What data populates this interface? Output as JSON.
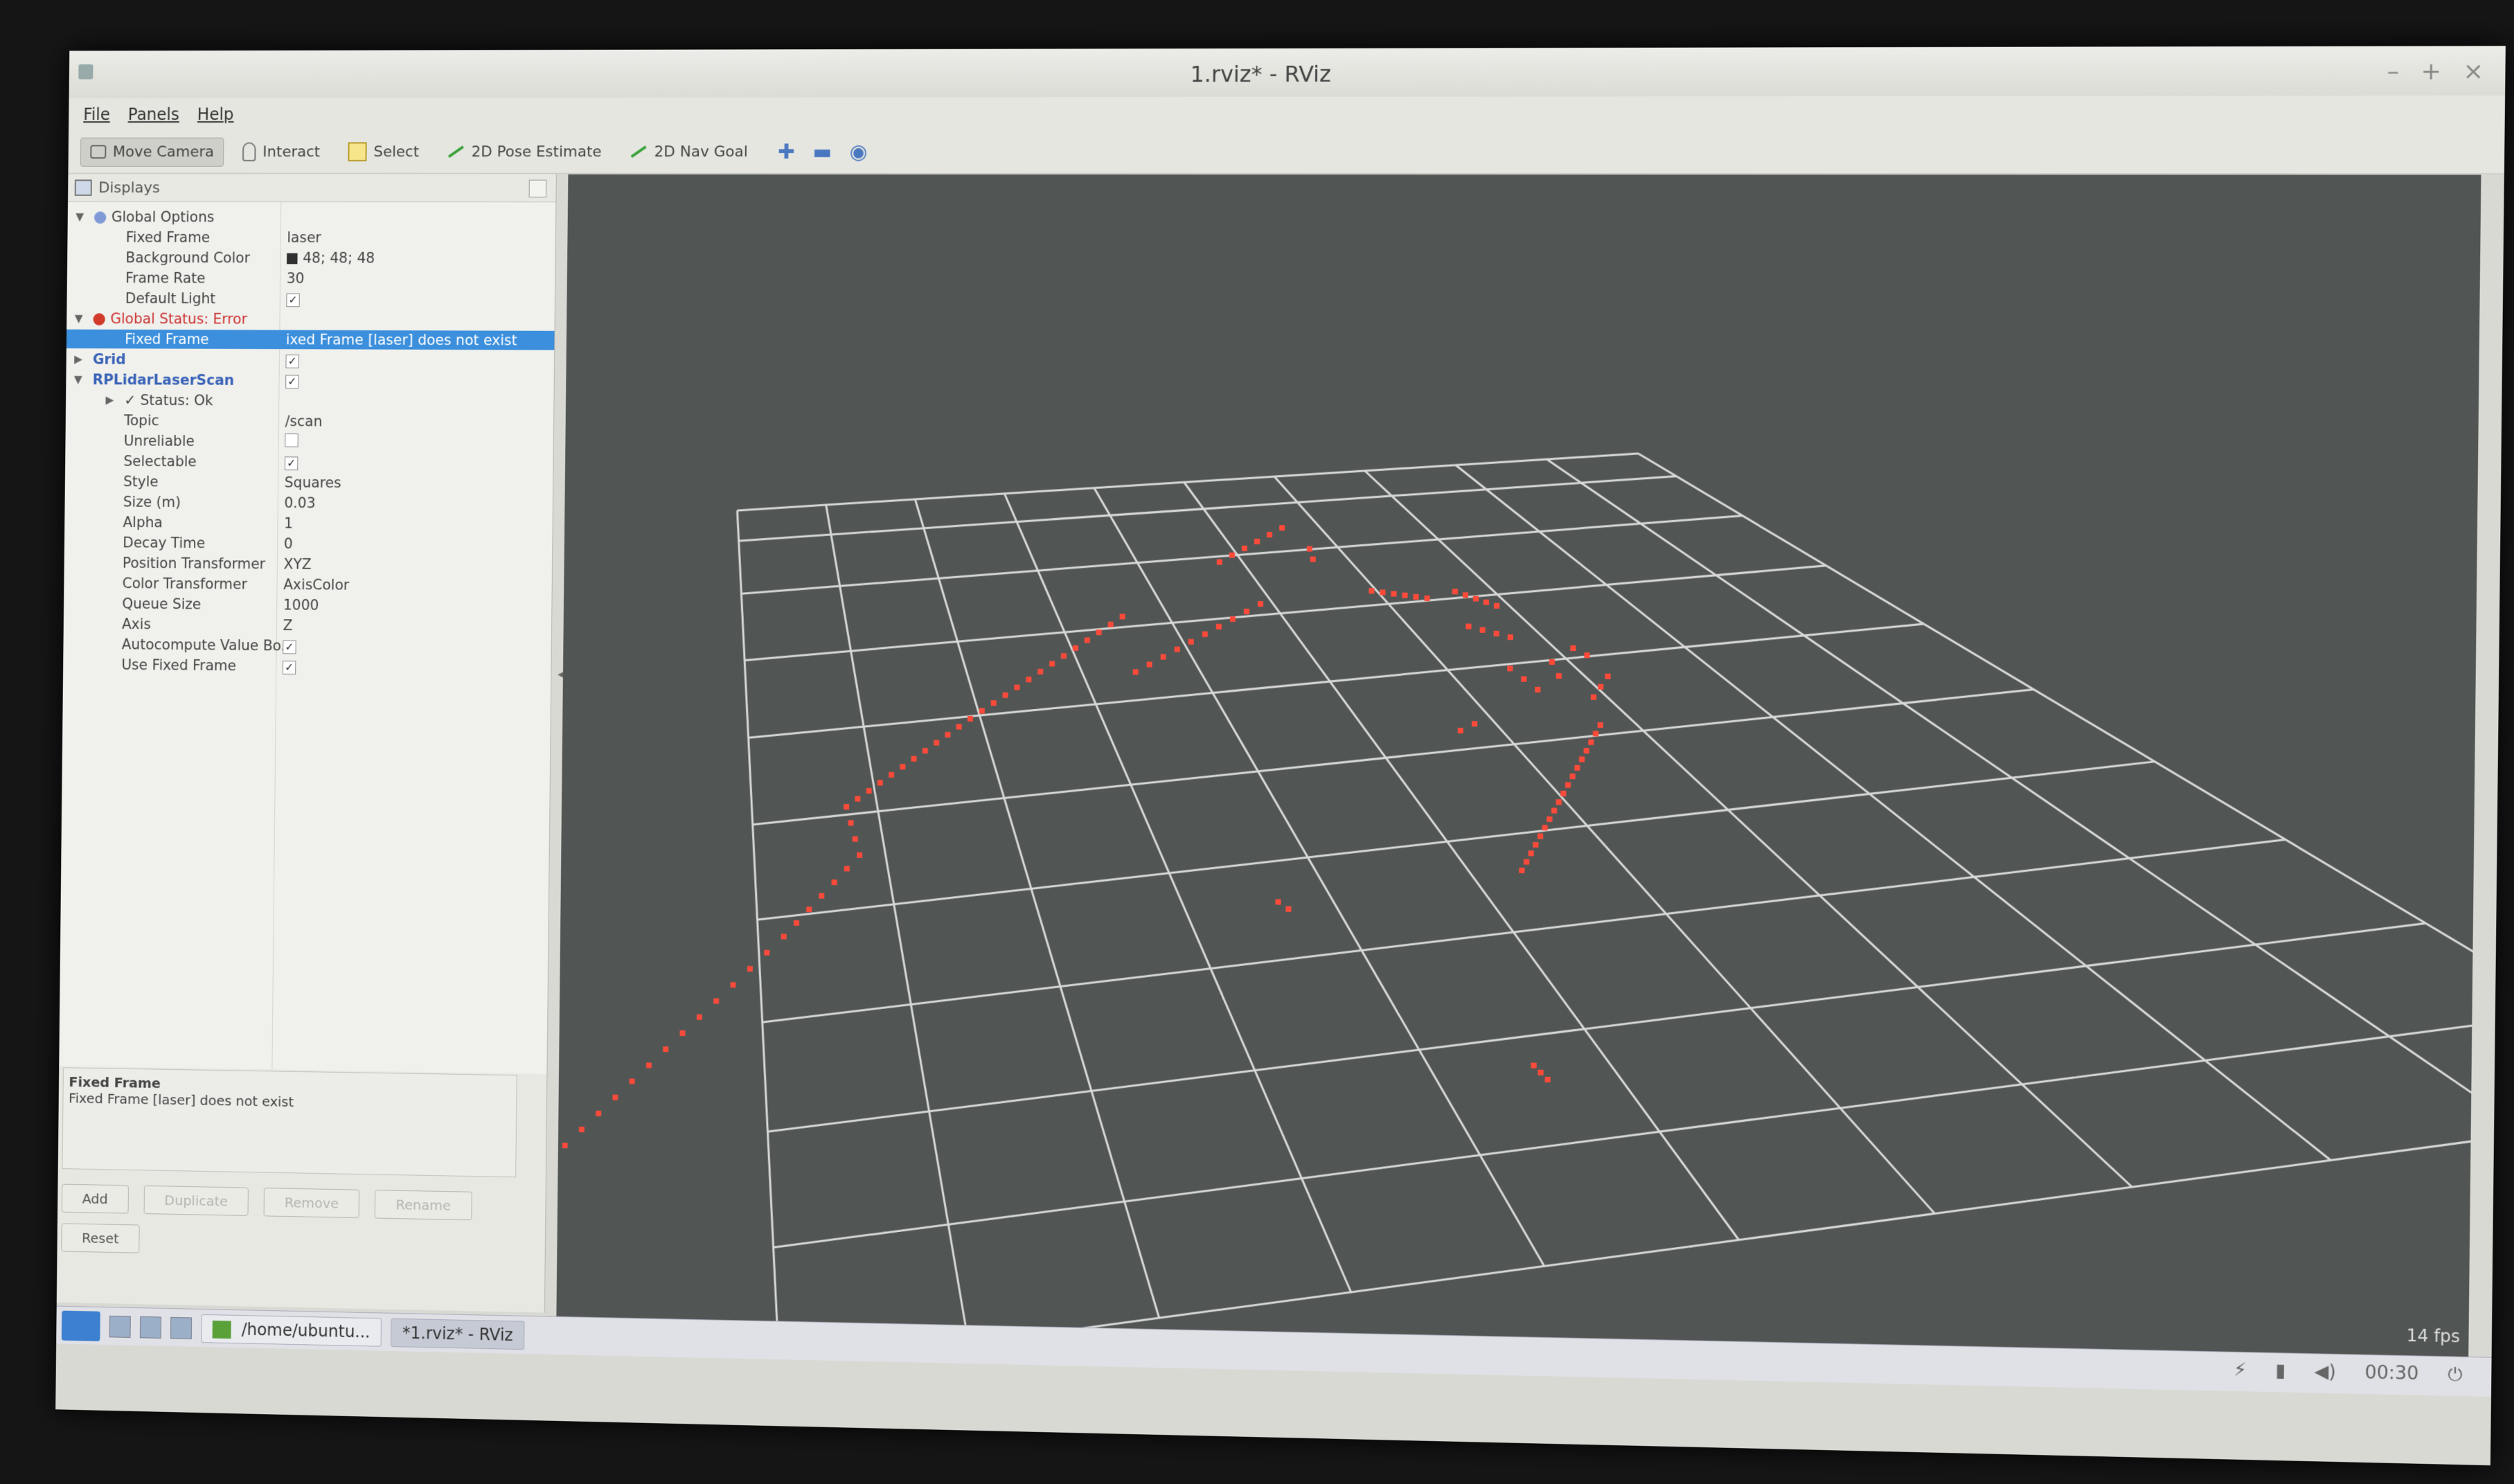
{
  "window": {
    "title": "1.rviz* - RViz",
    "controls": [
      "–",
      "+",
      "×"
    ]
  },
  "menu": [
    "File",
    "Panels",
    "Help"
  ],
  "toolbar": {
    "tools": [
      {
        "label": "Move Camera",
        "icon": "camera-icon",
        "active": true
      },
      {
        "label": "Interact",
        "icon": "hand-icon",
        "active": false
      },
      {
        "label": "Select",
        "icon": "select-icon",
        "active": false
      },
      {
        "label": "2D Pose Estimate",
        "icon": "arrow-icon",
        "active": false
      },
      {
        "label": "2D Nav Goal",
        "icon": "arrow-icon",
        "active": false
      }
    ],
    "extra_icons": [
      "plus-icon",
      "minus-icon",
      "eye-icon"
    ]
  },
  "displays": {
    "header": "Displays",
    "rows": [
      {
        "name": "Global Options",
        "value": "",
        "indent": 0,
        "tri": "▼",
        "type": "header"
      },
      {
        "name": "Fixed Frame",
        "value": "laser",
        "indent": 2
      },
      {
        "name": "Background Color",
        "value": "48; 48; 48",
        "indent": 2,
        "swatch": true
      },
      {
        "name": "Frame Rate",
        "value": "30",
        "indent": 2
      },
      {
        "name": "Default Light",
        "value": "",
        "indent": 2,
        "check": "✓"
      },
      {
        "name": "Global Status: Error",
        "value": "",
        "indent": 0,
        "tri": "▼",
        "type": "error"
      },
      {
        "name": "Fixed Frame",
        "value": "ixed Frame [laser] does not exist",
        "indent": 2,
        "type": "selected"
      },
      {
        "name": "Grid",
        "value": "",
        "indent": 0,
        "tri": "▶",
        "type": "bold",
        "check": "✓"
      },
      {
        "name": "RPLidarLaserScan",
        "value": "",
        "indent": 0,
        "tri": "▼",
        "type": "bold",
        "check": "✓"
      },
      {
        "name": "✓ Status: Ok",
        "value": "",
        "indent": 2,
        "tri": "▶"
      },
      {
        "name": "Topic",
        "value": "/scan",
        "indent": 2
      },
      {
        "name": "Unreliable",
        "value": "",
        "indent": 2,
        "check": " "
      },
      {
        "name": "Selectable",
        "value": "",
        "indent": 2,
        "check": "✓"
      },
      {
        "name": "Style",
        "value": "Squares",
        "indent": 2
      },
      {
        "name": "Size (m)",
        "value": "0.03",
        "indent": 2
      },
      {
        "name": "Alpha",
        "value": "1",
        "indent": 2
      },
      {
        "name": "Decay Time",
        "value": "0",
        "indent": 2
      },
      {
        "name": "Position Transformer",
        "value": "XYZ",
        "indent": 2
      },
      {
        "name": "Color Transformer",
        "value": "AxisColor",
        "indent": 2
      },
      {
        "name": "Queue Size",
        "value": "1000",
        "indent": 2
      },
      {
        "name": "Axis",
        "value": "Z",
        "indent": 2
      },
      {
        "name": "Autocompute Value Bo...",
        "value": "",
        "indent": 2,
        "check": "✓"
      },
      {
        "name": "Use Fixed Frame",
        "value": "",
        "indent": 2,
        "check": "✓"
      }
    ]
  },
  "description": {
    "title": "Fixed Frame",
    "text": "Fixed Frame [laser] does not exist"
  },
  "buttons": {
    "add": "Add",
    "duplicate": "Duplicate",
    "remove": "Remove",
    "rename": "Rename",
    "reset": "Reset"
  },
  "viewport": {
    "fps": "14 fps",
    "background": "#515654",
    "grid_color": "#d8d8d8",
    "point_color": "#ff4a3a"
  },
  "taskbar": {
    "tasks": [
      {
        "label": "/home/ubuntu...",
        "active": false
      },
      {
        "label": "*1.rviz* - RViz",
        "active": true
      }
    ],
    "clock": "00:30"
  }
}
